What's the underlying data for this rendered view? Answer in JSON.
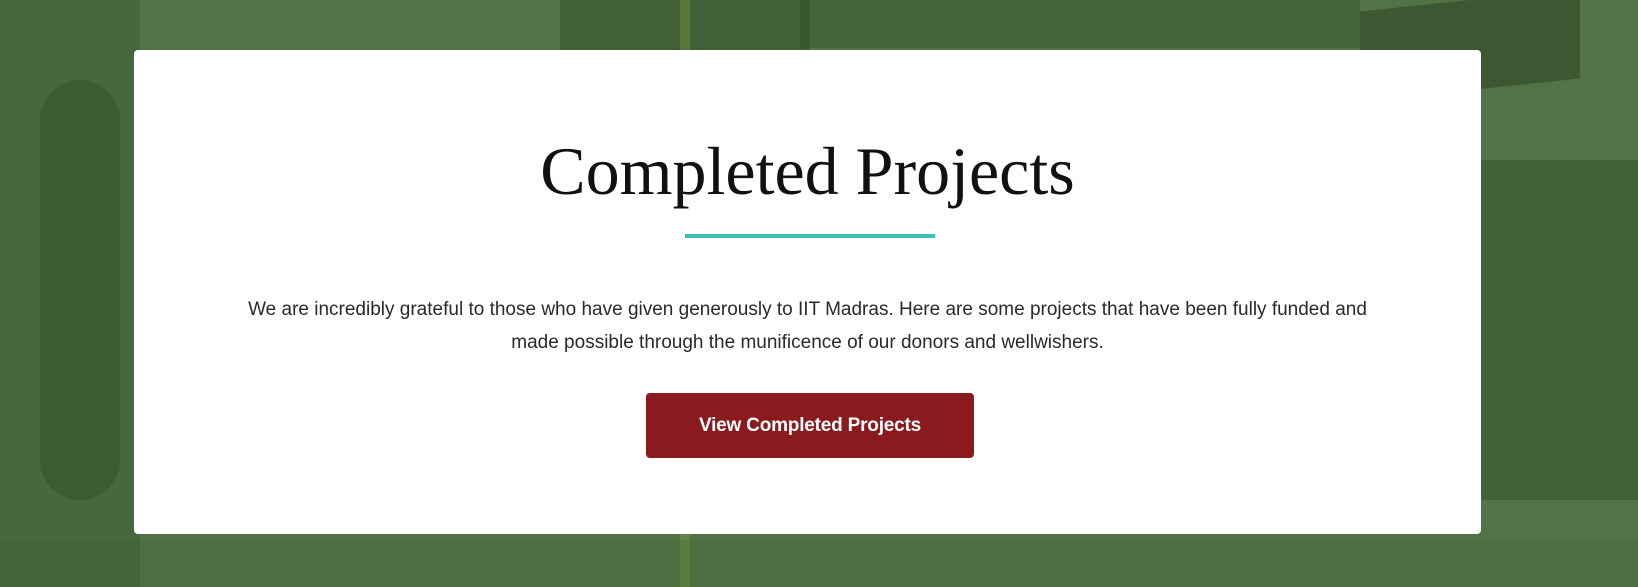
{
  "section": {
    "title": "Completed Projects",
    "description": "We are incredibly grateful to those who have given generously to IIT Madras. Here are some projects that have been fully funded and made possible through the munificence of our donors and wellwishers.",
    "button_label": "View Completed Projects"
  },
  "colors": {
    "background_overlay": "#527346",
    "card": "#ffffff",
    "accent_underline": "#3dbfb8",
    "button": "#8b1a1e",
    "button_text": "#ffffff",
    "title_text": "#111111"
  }
}
